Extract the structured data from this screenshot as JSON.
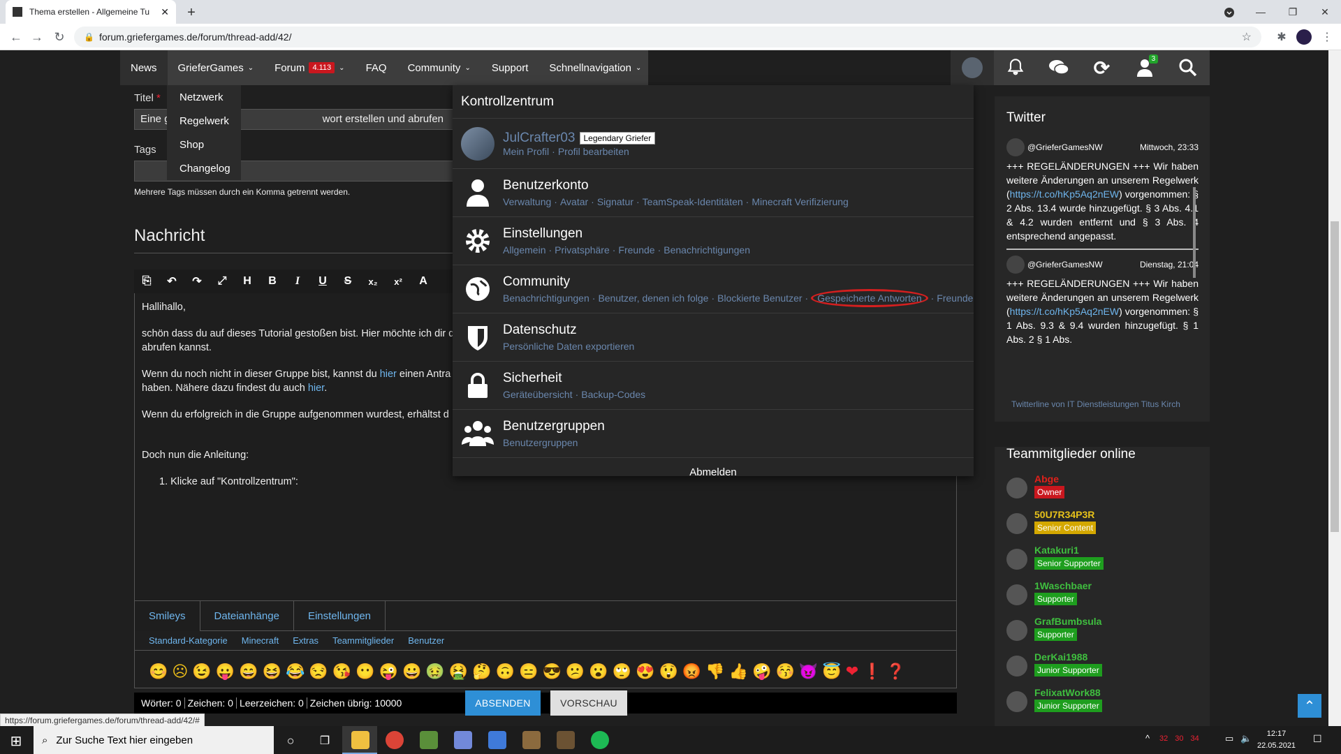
{
  "browser": {
    "tab_title": "Thema erstellen - Allgemeine Tu",
    "url": "forum.griefergames.de/forum/thread-add/42/",
    "status_url": "https://forum.griefergames.de/forum/thread-add/42/#"
  },
  "nav": {
    "items": [
      "News",
      "GrieferGames",
      "Forum",
      "FAQ",
      "Community",
      "Support",
      "Schnellnavigation"
    ],
    "forum_badge": "4.113",
    "conv_badge": "3"
  },
  "griefer_menu": [
    "Netzwerk",
    "Regelwerk",
    "Shop",
    "Changelog"
  ],
  "form": {
    "title_label": "Titel",
    "title_required": "*",
    "title_value_a": "Eine g",
    "title_value_b": "wort erstellen und abrufen",
    "tags_label": "Tags",
    "tags_hint": "Mehrere Tags müssen durch ein Komma getrennt werden.",
    "message_heading": "Nachricht"
  },
  "editor": {
    "p1": "Hallihallo,",
    "p2a": "schön dass du auf dieses Tutorial gestoßen bist. Hier möchte ich dir d",
    "p2b": "abrufen kannst.",
    "p3a": "Wenn du noch nicht in dieser Gruppe bist, kannst du ",
    "p3link": "hier",
    "p3b": " einen Antra",
    "p3c": "haben. Nähere dazu findest du auch ",
    "p3link2": "hier",
    "p3d": ".",
    "p4": "Wenn du erfolgreich in die Gruppe aufgenommen wurdest, erhältst d",
    "p5": "Doch nun die Anleitung:",
    "li1": "1. Klicke auf \"Kontrollzentrum\":"
  },
  "editor_tabs": [
    "Smileys",
    "Dateianhänge",
    "Einstellungen"
  ],
  "smiley_categories": [
    "Standard-Kategorie",
    "Minecraft",
    "Extras",
    "Teammitglieder",
    "Benutzer"
  ],
  "smileys": [
    "😊",
    "☹",
    "😉",
    "😛",
    "😄",
    "😆",
    "😂",
    "😒",
    "😘",
    "😶",
    "😜",
    "😀",
    "🤢",
    "🤮",
    "🤔",
    "🙃",
    "😑",
    "😎",
    "😕",
    "😮",
    "🙄",
    "😍",
    "😲",
    "😡",
    "👎",
    "👍",
    "🤪",
    "😚",
    "😈",
    "😇",
    "❤",
    "❗",
    "❓"
  ],
  "stats": [
    "Wörter: 0",
    "Zeichen: 0",
    "Leerzeichen: 0",
    "Zeichen übrig: 10000"
  ],
  "buttons": {
    "submit": "ABSENDEN",
    "preview": "VORSCHAU"
  },
  "kontrollzentrum": {
    "title": "Kontrollzentrum",
    "user": {
      "name": "JulCrafter03",
      "rank": "Legendary Griefer",
      "links": [
        "Mein Profil",
        "Profil bearbeiten"
      ]
    },
    "sections": [
      {
        "title": "Benutzerkonto",
        "links": [
          "Verwaltung",
          "Avatar",
          "Signatur",
          "TeamSpeak-Identitäten",
          "Minecraft Verifizierung"
        ]
      },
      {
        "title": "Einstellungen",
        "links": [
          "Allgemein",
          "Privatsphäre",
          "Freunde",
          "Benachrichtigungen"
        ]
      },
      {
        "title": "Community",
        "links": [
          "Benachrichtigungen",
          "Benutzer, denen ich folge",
          "Blockierte Benutzer",
          "Gespeicherte Antworten",
          "Freunde"
        ]
      },
      {
        "title": "Datenschutz",
        "links": [
          "Persönliche Daten exportieren"
        ]
      },
      {
        "title": "Sicherheit",
        "links": [
          "Geräteübersicht",
          "Backup-Codes"
        ]
      },
      {
        "title": "Benutzergruppen",
        "links": [
          "Benutzergruppen"
        ]
      }
    ],
    "logout": "Abmelden"
  },
  "twitter": {
    "title": "Twitter",
    "tweets": [
      {
        "user": "@GrieferGamesNW",
        "time": "Mittwoch, 23:33",
        "text": "+++ REGELÄNDERUNGEN +++ Wir haben weitere Änderungen an unserem Regelwerk (",
        "link": "https://t.co/hKp5Aq2nEW",
        "text2": ") vorgenommen: § 2 Abs. 13.4 wurde hinzugefügt. § 3 Abs. 4.1 & 4.2 wurden entfernt und § 3 Abs. 4 entsprechend angepasst."
      },
      {
        "user": "@GrieferGamesNW",
        "time": "Dienstag, 21:04",
        "text": "+++ REGELÄNDERUNGEN +++ Wir haben weitere Änderungen an unserem Regelwerk (",
        "link": "https://t.co/hKp5Aq2nEW",
        "text2": ") vorgenommen: § 1 Abs. 9.3 & 9.4 wurden hinzugefügt. § 1 Abs. 2 § 1 Abs."
      }
    ],
    "footer": "Twitterline von IT Dienstleistungen Titus Kirch"
  },
  "team": {
    "title": "Teammitglieder online",
    "members": [
      {
        "name": "Abge",
        "role": "Owner",
        "name_color": "#e0201a",
        "role_color": "#c9171e"
      },
      {
        "name": "50U7R34P3R",
        "role": "Senior Content",
        "name_color": "#e7c21a",
        "role_color": "#d4a800"
      },
      {
        "name": "Katakuri1",
        "role": "Senior Supporter",
        "name_color": "#3fbf3f",
        "role_color": "#1e9e1e"
      },
      {
        "name": "1Waschbaer",
        "role": "Supporter",
        "name_color": "#3fbf3f",
        "role_color": "#1e9e1e"
      },
      {
        "name": "GrafBumbsula",
        "role": "Supporter",
        "name_color": "#3fbf3f",
        "role_color": "#1e9e1e"
      },
      {
        "name": "DerKai1988",
        "role": "Junior Supporter",
        "name_color": "#3fbf3f",
        "role_color": "#1e9e1e"
      },
      {
        "name": "FelixatWork88",
        "role": "Junior Supporter",
        "name_color": "#3fbf3f",
        "role_color": "#1e9e1e"
      }
    ]
  },
  "taskbar": {
    "search_placeholder": "Zur Suche Text hier eingeben",
    "time": "12:17",
    "date": "22.05.2021",
    "temps": [
      "32",
      "30",
      "34"
    ]
  },
  "colors": {
    "link": "#6a87ad",
    "accent": "#2e8fd6",
    "highlight_circle": "#d41f1f"
  }
}
